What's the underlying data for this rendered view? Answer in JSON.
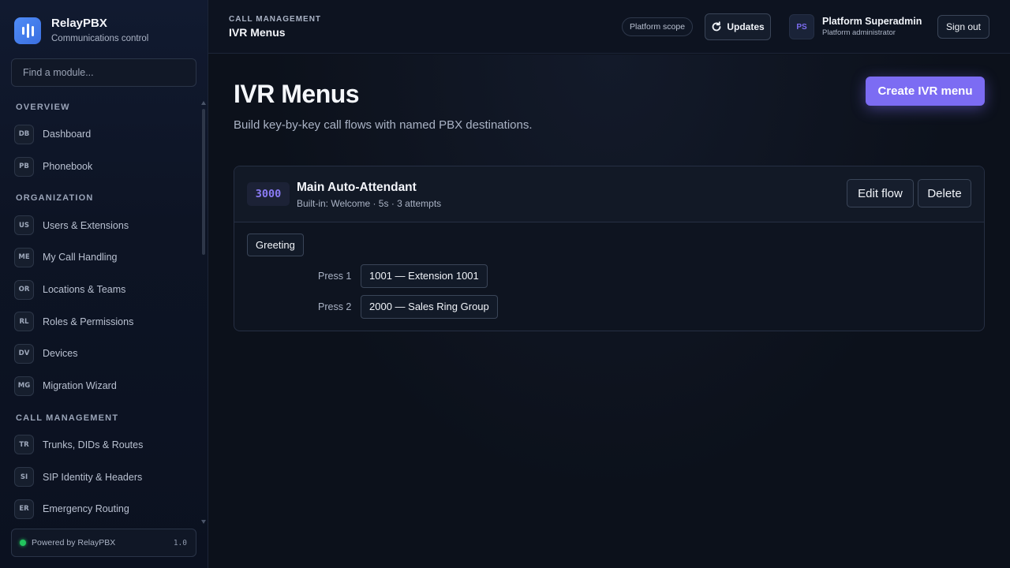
{
  "brand": {
    "name": "RelayPBX",
    "subtitle": "Communications control"
  },
  "search": {
    "placeholder": "Find a module..."
  },
  "nav": {
    "sections": [
      {
        "title": "OVERVIEW",
        "items": [
          {
            "badge": "DB",
            "label": "Dashboard"
          },
          {
            "badge": "PB",
            "label": "Phonebook"
          }
        ]
      },
      {
        "title": "ORGANIZATION",
        "items": [
          {
            "badge": "US",
            "label": "Users & Extensions"
          },
          {
            "badge": "ME",
            "label": "My Call Handling"
          },
          {
            "badge": "OR",
            "label": "Locations & Teams"
          },
          {
            "badge": "RL",
            "label": "Roles & Permissions"
          },
          {
            "badge": "DV",
            "label": "Devices"
          },
          {
            "badge": "MG",
            "label": "Migration Wizard"
          }
        ]
      },
      {
        "title": "CALL MANAGEMENT",
        "items": [
          {
            "badge": "TR",
            "label": "Trunks, DIDs & Routes"
          },
          {
            "badge": "SI",
            "label": "SIP Identity & Headers"
          },
          {
            "badge": "ER",
            "label": "Emergency Routing"
          }
        ]
      }
    ]
  },
  "footer": {
    "text": "Powered by RelayPBX",
    "version": "1.0"
  },
  "header": {
    "breadcrumb": "CALL MANAGEMENT",
    "title": "IVR Menus",
    "scope_pill": "Platform scope",
    "updates_label": "Updates",
    "avatar_initials": "PS",
    "user_name": "Platform Superadmin",
    "user_role": "Platform administrator",
    "signout_label": "Sign out"
  },
  "main": {
    "title": "IVR Menus",
    "subtitle": "Build key-by-key call flows with named PBX destinations.",
    "create_label": "Create IVR menu",
    "menus": [
      {
        "number": "3000",
        "name": "Main Auto-Attendant",
        "meta": "Built-in: Welcome · 5s · 3 attempts",
        "edit_label": "Edit flow",
        "delete_label": "Delete",
        "greeting_label": "Greeting",
        "options": [
          {
            "key": "Press 1",
            "destination": "1001 — Extension 1001"
          },
          {
            "key": "Press 2",
            "destination": "2000 — Sales Ring Group"
          }
        ]
      }
    ]
  },
  "colors": {
    "accent": "#7c6cf3",
    "status_ok": "#22c55e",
    "background": "#0c111b"
  }
}
